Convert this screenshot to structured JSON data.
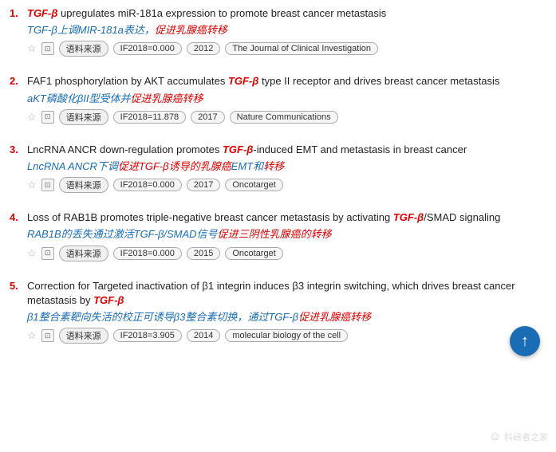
{
  "results": [
    {
      "number": "1.",
      "title_parts": [
        {
          "text": " upregulates miR-181a expression to promote breast cancer metastasis",
          "italic_tgfb": false,
          "prefix": "TGF-β"
        }
      ],
      "title_prefix_italic": true,
      "subtitle": "TGF-β上调MIR-181a表达，促进乳腺癌转移",
      "subtitle_highlights": [
        "促进乳腺癌转移"
      ],
      "meta": {
        "if": "IF2018=0.000",
        "year": "2012",
        "journal": "The Journal of Clinical Investigation",
        "source_label": "语料来源"
      }
    },
    {
      "number": "2.",
      "title_parts": [
        {
          "text": "FAF1 phosphorylation by AKT accumulates ",
          "italic_tgfb": false
        },
        {
          "text": "TGF-β",
          "italic_tgfb": true
        },
        {
          "text": " type II receptor and drives breast cancer metastasis",
          "italic_tgfb": false
        }
      ],
      "subtitle": "aKT磷酸化βII型受体并促进乳腺癌转移",
      "subtitle_highlights": [
        "促进乳腺癌转移"
      ],
      "meta": {
        "if": "IF2018=11.878",
        "year": "2017",
        "journal": "Nature Communications",
        "source_label": "语料来源"
      }
    },
    {
      "number": "3.",
      "title_parts": [
        {
          "text": "LncRNA ANCR down-regulation promotes ",
          "italic_tgfb": false
        },
        {
          "text": "TGF-β",
          "italic_tgfb": true
        },
        {
          "text": "-induced EMT and metastasis in breast cancer",
          "italic_tgfb": false
        }
      ],
      "subtitle": "LncRNA ANCR下调促进TGF-β诱导的乳腺癌EMT和转移",
      "subtitle_highlights": [
        "促进TGF-β诱导的",
        "乳腺癌",
        "EMT和转移"
      ],
      "meta": {
        "if": "IF2018=0.000",
        "year": "2017",
        "journal": "Oncotarget",
        "source_label": "语料来源"
      }
    },
    {
      "number": "4.",
      "title_parts": [
        {
          "text": "Loss of RAB1B promotes triple-negative breast cancer metastasis by activating ",
          "italic_tgfb": false
        },
        {
          "text": "TGF-β",
          "italic_tgfb": true
        },
        {
          "text": "/SMAD signaling",
          "italic_tgfb": false
        }
      ],
      "subtitle": "RAB1B的丢失通过激活TGF-β/SMAD信号促进三阴性乳腺癌的转移",
      "subtitle_highlights": [
        "促进三阴性乳腺癌的转移"
      ],
      "meta": {
        "if": "IF2018=0.000",
        "year": "2015",
        "journal": "Oncotarget",
        "source_label": "语料来源"
      }
    },
    {
      "number": "5.",
      "title_parts": [
        {
          "text": "Correction for Targeted inactivation of β1 integrin induces β3 integrin switching, which drives breast cancer metastasis by ",
          "italic_tgfb": false
        },
        {
          "text": "TGF-β",
          "italic_tgfb": true
        }
      ],
      "subtitle": "β1整合素靶向失活的校正可诱导β3整合素切换，通过TGF-β促进乳腺癌转移",
      "subtitle_highlights": [
        "促进乳腺癌转移"
      ],
      "meta": {
        "if": "IF2018=3.905",
        "year": "2014",
        "journal": "molecular biology of the cell",
        "source_label": "语料来源"
      }
    }
  ],
  "scroll_up_label": "↑",
  "watermark": "科研者之家"
}
